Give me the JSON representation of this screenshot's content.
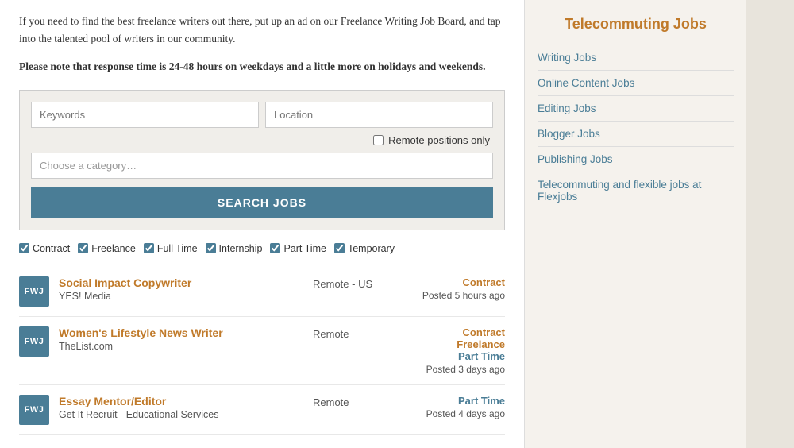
{
  "intro": {
    "text1": "If you need to find the best freelance writers out there, put up an ad on our Freelance Writing Job Board, and tap into the talented pool of writers in our community.",
    "text2": "Please note that response time is 24-48 hours on weekdays and a little more on holidays and weekends."
  },
  "search": {
    "keywords_placeholder": "Keywords",
    "location_placeholder": "Location",
    "remote_label": "Remote positions only",
    "category_placeholder": "Choose a category…",
    "button_label": "SEARCH JOBS"
  },
  "filters": [
    {
      "id": "contract",
      "label": "Contract",
      "checked": true
    },
    {
      "id": "freelance",
      "label": "Freelance",
      "checked": true
    },
    {
      "id": "fulltime",
      "label": "Full Time",
      "checked": true
    },
    {
      "id": "internship",
      "label": "Internship",
      "checked": true
    },
    {
      "id": "parttime",
      "label": "Part Time",
      "checked": true
    },
    {
      "id": "temporary",
      "label": "Temporary",
      "checked": true
    }
  ],
  "jobs": [
    {
      "logo": "FWJ",
      "title": "Social Impact Copywriter",
      "company": "YES! Media",
      "location": "Remote - US",
      "types": [
        {
          "label": "Contract",
          "class": "contract"
        }
      ],
      "posted": "Posted 5 hours ago"
    },
    {
      "logo": "FWJ",
      "title": "Women's Lifestyle News Writer",
      "company": "TheList.com",
      "location": "Remote",
      "types": [
        {
          "label": "Contract",
          "class": "contract"
        },
        {
          "label": "Freelance",
          "class": "freelance"
        },
        {
          "label": "Part Time",
          "class": "part-time"
        }
      ],
      "posted": "Posted 3 days ago"
    },
    {
      "logo": "FWJ",
      "title": "Essay Mentor/Editor",
      "company": "Get It Recruit - Educational Services",
      "location": "Remote",
      "types": [
        {
          "label": "Part Time",
          "class": "part-time"
        }
      ],
      "posted": "Posted 4 days ago"
    }
  ],
  "sidebar": {
    "title": "Telecommuting Jobs",
    "links": [
      "Writing Jobs",
      "Online Content Jobs",
      "Editing Jobs",
      "Blogger Jobs",
      "Publishing Jobs",
      "Telecommuting and flexible jobs at Flexjobs"
    ]
  }
}
